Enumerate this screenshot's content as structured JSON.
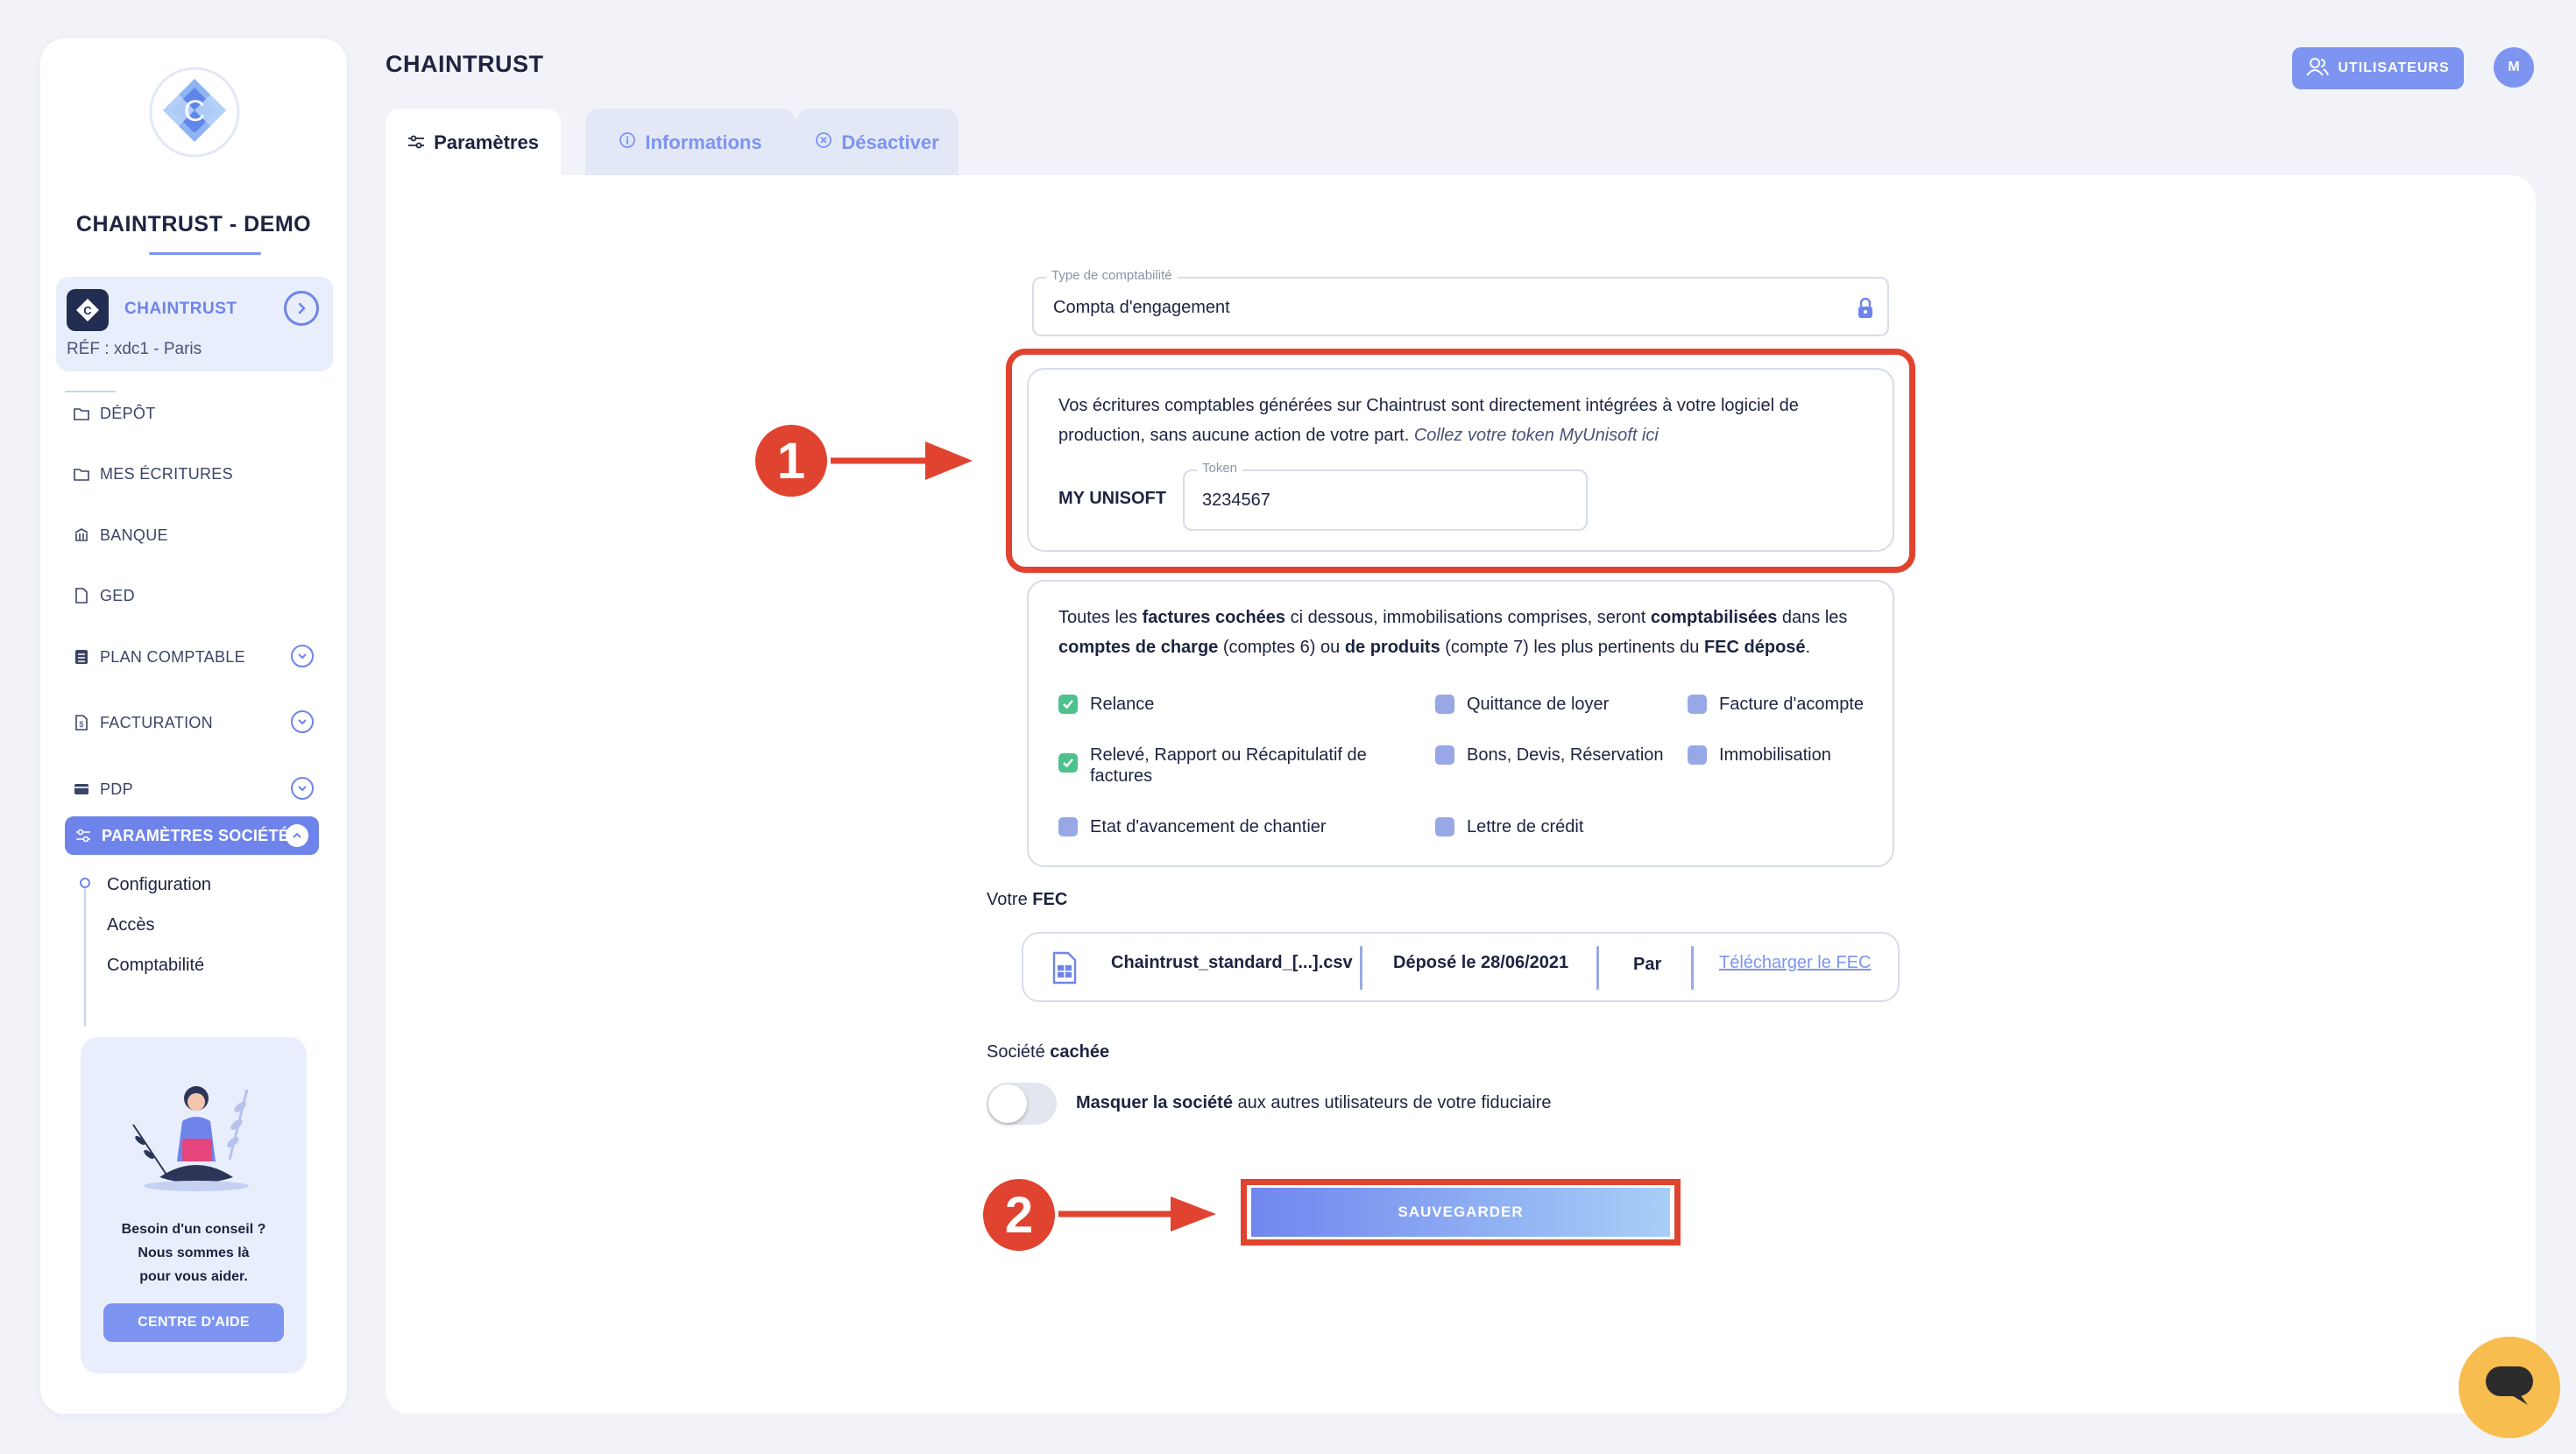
{
  "sidebar": {
    "company_name": "CHAINTRUST - DEMO",
    "org": {
      "name": "CHAINTRUST",
      "ref": "RÉF : xdc1 - Paris"
    },
    "nav": [
      {
        "label": "DÉPÔT",
        "icon": "folder-icon"
      },
      {
        "label": "MES ÉCRITURES",
        "icon": "folder-icon"
      },
      {
        "label": "BANQUE",
        "icon": "bank-icon"
      },
      {
        "label": "GED",
        "icon": "document-icon"
      },
      {
        "label": "PLAN COMPTABLE",
        "icon": "ledger-icon",
        "expandable": true
      },
      {
        "label": "FACTURATION",
        "icon": "invoice-icon",
        "expandable": true
      },
      {
        "label": "PDP",
        "icon": "card-icon",
        "expandable": true
      }
    ],
    "active": {
      "label": "PARAMÈTRES SOCIÉTÉ",
      "icon": "sliders-icon"
    },
    "sub_items": [
      "Configuration",
      "Accès",
      "Comptabilité"
    ],
    "help": {
      "line1": "Besoin d'un conseil ?",
      "line2": "Nous sommes là",
      "line3": "pour vous aider.",
      "button": "CENTRE D'AIDE"
    }
  },
  "header": {
    "title": "CHAINTRUST",
    "users_button": "UTILISATEURS",
    "avatar_initial": "M"
  },
  "tabs": [
    {
      "label": "Paramètres",
      "icon": "sliders-icon",
      "active": true
    },
    {
      "label": "Informations",
      "icon": "info-icon",
      "active": false
    },
    {
      "label": "Désactiver",
      "icon": "x-circle-icon",
      "active": false
    }
  ],
  "form": {
    "accounting_type": {
      "legend": "Type de comptabilité",
      "value": "Compta d'engagement"
    },
    "integration": {
      "text": "Vos écritures comptables générées sur Chaintrust sont directement intégrées à votre logiciel de production, sans aucune action de votre part.",
      "hint": "Collez votre token MyUnisoft ici",
      "label": "MY UNISOFT",
      "token_legend": "Token",
      "token_value": "3234567"
    },
    "invoices": {
      "t1": "Toutes les ",
      "b1": "factures cochées",
      "t2": " ci dessous, immobilisations comprises, seront ",
      "b2": "comptabilisées",
      "t3": " dans les ",
      "b3": "comptes de charge",
      "t4": " (comptes 6) ou ",
      "b4": "de produits",
      "t5": " (compte 7) les plus pertinents du ",
      "b5": "FEC déposé",
      "t6": ".",
      "checkboxes": [
        {
          "label": "Relance",
          "checked": true
        },
        {
          "label": "Quittance de loyer",
          "checked": false
        },
        {
          "label": "Facture d'acompte",
          "checked": false
        },
        {
          "label": "Relevé, Rapport ou Récapitulatif de factures",
          "checked": true
        },
        {
          "label": "Bons, Devis, Réservation",
          "checked": false
        },
        {
          "label": "Immobilisation",
          "checked": false
        },
        {
          "label": "Etat d'avancement de chantier",
          "checked": false
        },
        {
          "label": "Lettre de crédit",
          "checked": false
        }
      ]
    },
    "fec": {
      "label_prefix": "Votre ",
      "label_bold": "FEC",
      "file": "Chaintrust_standard_[...].csv",
      "deposited": "Déposé le  28/06/2021",
      "by": "Par",
      "download": "Télécharger le FEC"
    },
    "hidden": {
      "label_prefix": "Société ",
      "label_bold": "cachée",
      "toggle_bold": "Masquer la société",
      "toggle_text": " aux autres utilisateurs de votre fiduciaire",
      "enabled": false
    },
    "save_button": "SAUVEGARDER"
  },
  "annotations": {
    "step1": "1",
    "step2": "2"
  },
  "colors": {
    "accent": "#7d94f0",
    "annotation": "#e0432f",
    "check": "#4ec28d",
    "chat": "#f7bd4f"
  }
}
